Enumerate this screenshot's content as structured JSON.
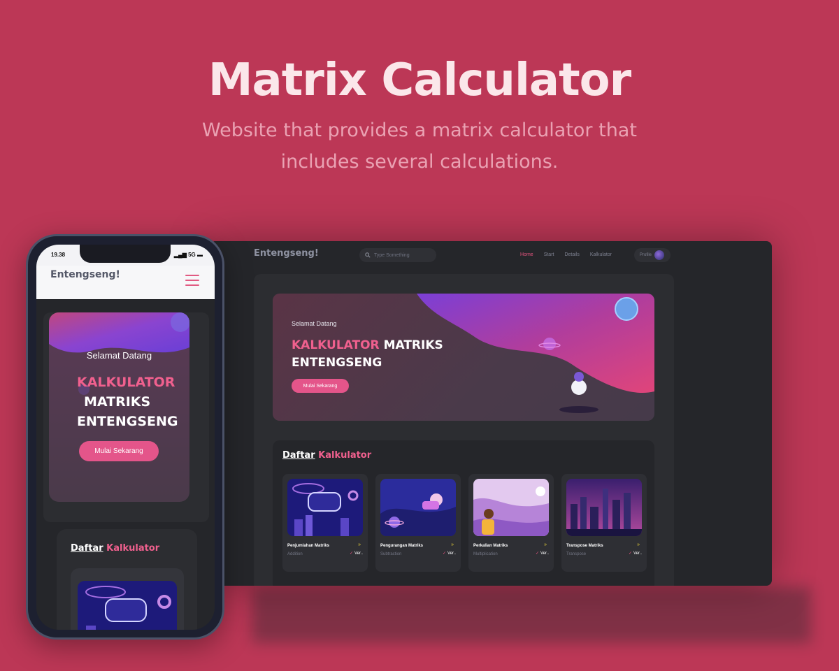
{
  "hero": {
    "title": "Matrix Calculator",
    "subtitle": "Website that provides a matrix calculator that includes several calculations."
  },
  "desktop": {
    "logo": "Entengseng!",
    "search_placeholder": "Type Something",
    "nav": [
      "Home",
      "Start",
      "Details",
      "Kalkulator"
    ],
    "profile_label": "Profile",
    "banner": {
      "greeting": "Selamat Datang",
      "title_pink": "KALKULATOR",
      "title_white_1": "MATRIKS",
      "title_white_2": "ENTENGSENG",
      "button": "Mulai Sekarang"
    },
    "list": {
      "title_underlined": "Daftar",
      "title_pink": "Kalkulator",
      "cards": [
        {
          "name": "Penjumlahan Matriks",
          "category": "Addition",
          "badge": "Ver.."
        },
        {
          "name": "Pengurangan Matriks",
          "category": "Subtraction",
          "badge": "Ver.."
        },
        {
          "name": "Perkalian Matriks",
          "category": "Multiplication",
          "badge": "Ver.."
        },
        {
          "name": "Transpose Matriks",
          "category": "Transpose",
          "badge": "Ver.."
        }
      ]
    }
  },
  "phone": {
    "status_time": "19.38",
    "status_network": "5G",
    "logo": "Entengseng!",
    "banner": {
      "greeting": "Selamat Datang",
      "title_pink": "KALKULATOR",
      "title_white_1": "MATRIKS",
      "title_white_2": "ENTENGSENG",
      "button": "Mulai Sekarang"
    },
    "list": {
      "title_underlined": "Daftar",
      "title_pink": "Kalkulator"
    }
  },
  "colors": {
    "background": "#bc3756",
    "accent": "#e4558a",
    "surface": "#25262a",
    "panel": "#2c2d31"
  },
  "icons": [
    "search-icon",
    "avatar",
    "hamburger-icon",
    "chevrons-right-icon",
    "check-icon"
  ]
}
